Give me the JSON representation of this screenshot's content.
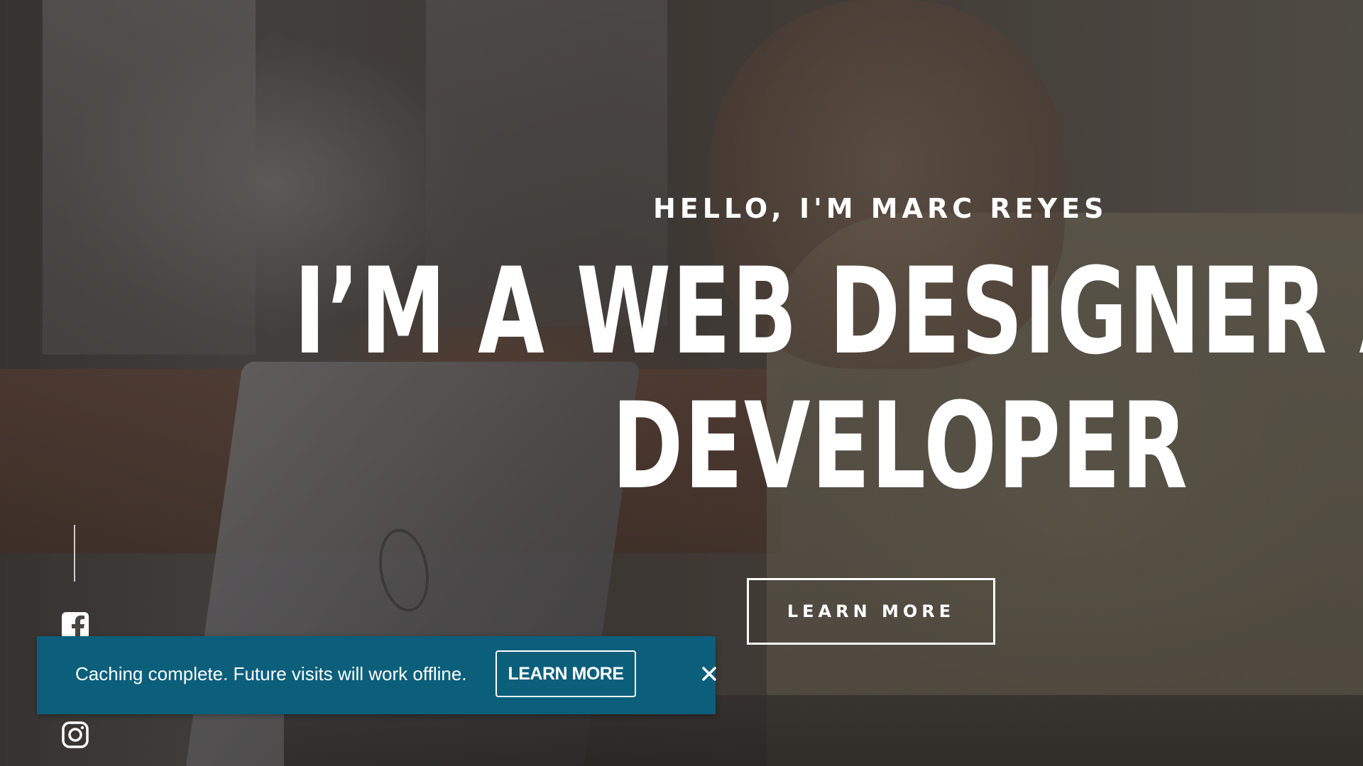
{
  "hero": {
    "greeting": "HELLO, I'M MARC REYES",
    "headline_line1": "I’M A WEB DESIGNER AND",
    "headline_line2": "DEVELOPER",
    "cta_label": "LEARN MORE"
  },
  "social": {
    "icons": [
      "facebook-icon",
      "instagram-icon"
    ]
  },
  "toast": {
    "message": "Caching complete. Future visits will work offline.",
    "button_label": "LEARN MORE",
    "close_icon": "close-icon",
    "background_color": "#0b5f7b"
  }
}
